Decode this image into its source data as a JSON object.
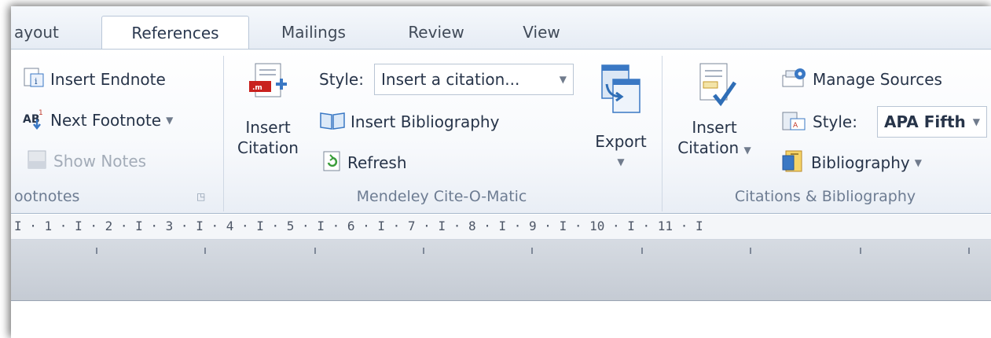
{
  "tabs": [
    {
      "label": "ayout"
    },
    {
      "label": "References"
    },
    {
      "label": "Mailings"
    },
    {
      "label": "Review"
    },
    {
      "label": "View"
    }
  ],
  "footnotes": {
    "insert_endnote": "Insert Endnote",
    "next_footnote": "Next Footnote",
    "show_notes": "Show Notes",
    "group_label": "ootnotes"
  },
  "mendeley": {
    "insert_citation_line1": "Insert",
    "insert_citation_line2": "Citation",
    "style_label": "Style:",
    "style_value": "Insert a citation...",
    "insert_bibliography": "Insert Bibliography",
    "refresh": "Refresh",
    "export": "Export",
    "group_label": "Mendeley Cite-O-Matic"
  },
  "citations": {
    "insert_citation_line1": "Insert",
    "insert_citation_line2": "Citation",
    "manage_sources": "Manage Sources",
    "style_label": "Style:",
    "style_value": "APA Fifth",
    "bibliography": "Bibliography",
    "group_label": "Citations & Bibliography"
  },
  "ruler": {
    "text": "I · 1 · I · 2 · I · 3 · I · 4 · I · 5 · I · 6 · I · 7 · I · 8 · I · 9 · I · 10 · I · 11 · I"
  },
  "colors": {
    "accent_blue": "#3a78c4",
    "tab_text": "#404a58",
    "group_label": "#6d7c92"
  }
}
